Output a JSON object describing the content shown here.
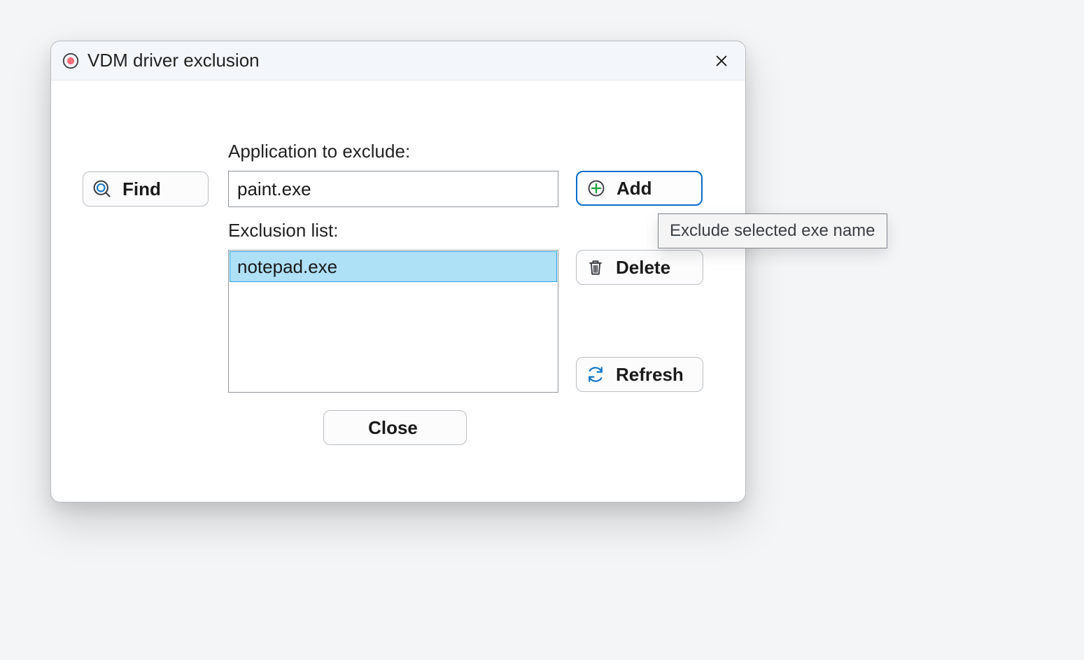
{
  "window": {
    "title": "VDM driver exclusion"
  },
  "labels": {
    "application_to_exclude": "Application to exclude:",
    "exclusion_list": "Exclusion list:"
  },
  "buttons": {
    "find": "Find",
    "add": "Add",
    "delete": "Delete",
    "refresh": "Refresh",
    "close": "Close"
  },
  "inputs": {
    "application_value": "paint.exe"
  },
  "list": {
    "items": [
      "notepad.exe"
    ],
    "selected_index": 0
  },
  "tooltip": {
    "add": "Exclude selected exe name"
  }
}
